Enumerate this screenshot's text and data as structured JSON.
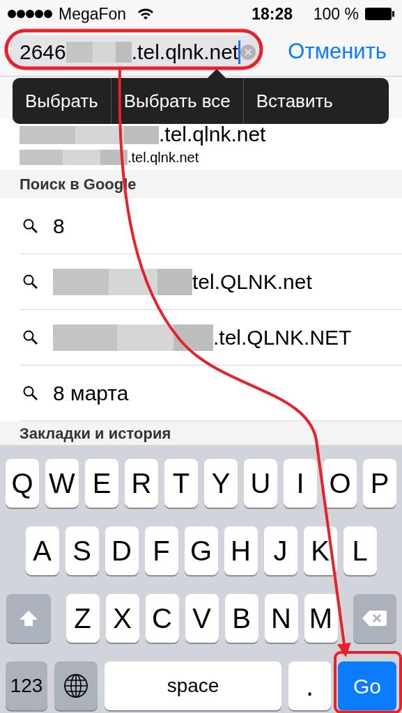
{
  "status_bar": {
    "carrier": "MegaFon",
    "time": "18:28",
    "battery": "100 %"
  },
  "address_bar": {
    "value_prefix": "2646",
    "redacted": true,
    "value_suffix": ".tel.qlnk.net",
    "cancel": "Отменить"
  },
  "edit_menu": [
    {
      "label": "Выбрать"
    },
    {
      "label": "Выбрать все"
    },
    {
      "label": "Вставить"
    }
  ],
  "top_hits": [
    {
      "text": ".tel.qlnk.net",
      "redacted": true,
      "kind": "title"
    },
    {
      "text": ".tel.qlnk.net",
      "redacted": true,
      "kind": "address"
    }
  ],
  "sections": [
    {
      "title": "Поиск в Google",
      "items": [
        {
          "text": "8",
          "redacted": false
        },
        {
          "text": "tel.QLNK.net",
          "redacted": true
        },
        {
          "text": ".tel.QLNK.NET",
          "redacted": true
        },
        {
          "text": "8 марта",
          "redacted": false
        }
      ]
    },
    {
      "title": "Закладки и история"
    }
  ],
  "keyboard": {
    "rows": [
      {
        "keys": [
          {
            "kind": "letter",
            "label": "Q"
          },
          {
            "kind": "letter",
            "label": "W"
          },
          {
            "kind": "letter",
            "label": "E"
          },
          {
            "kind": "letter",
            "label": "R"
          },
          {
            "kind": "letter",
            "label": "T"
          },
          {
            "kind": "letter",
            "label": "Y"
          },
          {
            "kind": "letter",
            "label": "U"
          },
          {
            "kind": "letter",
            "label": "I"
          },
          {
            "kind": "letter",
            "label": "O"
          },
          {
            "kind": "letter",
            "label": "P"
          }
        ]
      },
      {
        "keys": [
          {
            "kind": "letter",
            "label": "A"
          },
          {
            "kind": "letter",
            "label": "S"
          },
          {
            "kind": "letter",
            "label": "D"
          },
          {
            "kind": "letter",
            "label": "F"
          },
          {
            "kind": "letter",
            "label": "G"
          },
          {
            "kind": "letter",
            "label": "H"
          },
          {
            "kind": "letter",
            "label": "J"
          },
          {
            "kind": "letter",
            "label": "K"
          },
          {
            "kind": "letter",
            "label": "L"
          }
        ]
      },
      {
        "keys": [
          {
            "kind": "shift"
          },
          {
            "kind": "letter",
            "label": "Z"
          },
          {
            "kind": "letter",
            "label": "X"
          },
          {
            "kind": "letter",
            "label": "C"
          },
          {
            "kind": "letter",
            "label": "V"
          },
          {
            "kind": "letter",
            "label": "B"
          },
          {
            "kind": "letter",
            "label": "N"
          },
          {
            "kind": "letter",
            "label": "M"
          },
          {
            "kind": "delete"
          }
        ]
      },
      {
        "keys": [
          {
            "kind": "mode",
            "label": "123"
          },
          {
            "kind": "globe"
          },
          {
            "kind": "space",
            "label": "space"
          },
          {
            "kind": "punct",
            "label": "."
          },
          {
            "kind": "go",
            "label": "Go"
          }
        ]
      }
    ]
  },
  "annotations": [
    {
      "kind": "ellipse"
    },
    {
      "kind": "arrow"
    },
    {
      "kind": "frame"
    }
  ]
}
